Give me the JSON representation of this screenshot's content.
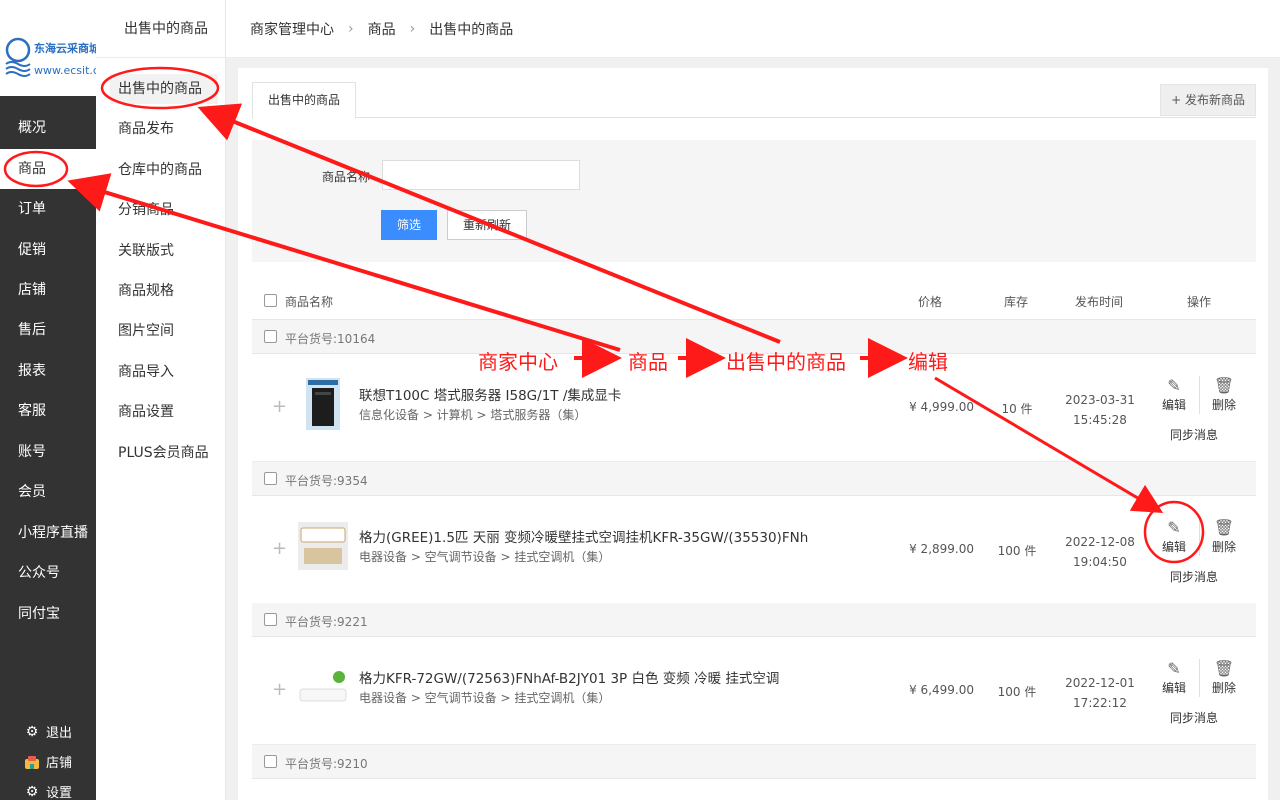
{
  "brand": {
    "name": "东海云采商城",
    "url": "www.ecsit.cn"
  },
  "sidebar": {
    "items": [
      {
        "label": "概况"
      },
      {
        "label": "商品"
      },
      {
        "label": "订单"
      },
      {
        "label": "促销"
      },
      {
        "label": "店铺"
      },
      {
        "label": "售后"
      },
      {
        "label": "报表"
      },
      {
        "label": "客服"
      },
      {
        "label": "账号"
      },
      {
        "label": "会员"
      },
      {
        "label": "小程序直播"
      },
      {
        "label": "公众号"
      },
      {
        "label": "同付宝"
      }
    ],
    "bottom": {
      "logout": "退出",
      "shop": "店铺",
      "settings": "设置"
    }
  },
  "subnav": {
    "title": "出售中的商品",
    "items": [
      {
        "label": "出售中的商品"
      },
      {
        "label": "商品发布"
      },
      {
        "label": "仓库中的商品"
      },
      {
        "label": "分销商品"
      },
      {
        "label": "关联版式"
      },
      {
        "label": "商品规格"
      },
      {
        "label": "图片空间"
      },
      {
        "label": "商品导入"
      },
      {
        "label": "商品设置"
      },
      {
        "label": "PLUS会员商品"
      }
    ]
  },
  "breadcrumb": {
    "root": "商家管理中心",
    "level1": "商品",
    "level2": "出售中的商品",
    "sep": "›"
  },
  "tabs": {
    "active": "出售中的商品",
    "publish_btn": "+ 发布新商品"
  },
  "filter": {
    "name_label": "商品名称",
    "name_value": "",
    "filter_btn": "筛选",
    "refresh_btn": "重新刷新"
  },
  "table": {
    "headers": {
      "name": "商品名称",
      "price": "价格",
      "stock": "库存",
      "time": "发布时间",
      "actions": "操作"
    },
    "edit_label": "编辑",
    "delete_label": "删除",
    "sync_label": "同步消息",
    "rows": [
      {
        "sku": "平台货号:10164",
        "name": "联想T100C 塔式服务器 I58G/1T /集成显卡",
        "category": "信息化设备 > 计算机 > 塔式服务器（集）",
        "price": "¥ 4,999.00",
        "stock": "10 件",
        "date": "2023-03-31",
        "time": "15:45:28"
      },
      {
        "sku": "平台货号:9354",
        "name": "格力(GREE)1.5匹 天丽 变频冷暖壁挂式空调挂机KFR-35GW/(35530)FNh",
        "category": "电器设备 > 空气调节设备 > 挂式空调机（集）",
        "price": "¥ 2,899.00",
        "stock": "100 件",
        "date": "2022-12-08",
        "time": "19:04:50"
      },
      {
        "sku": "平台货号:9221",
        "name": "格力KFR-72GW/(72563)FNhAf-B2JY01 3P 白色 变频 冷暖 挂式空调",
        "category": "电器设备 > 空气调节设备 > 挂式空调机（集）",
        "price": "¥ 6,499.00",
        "stock": "100 件",
        "date": "2022-12-01",
        "time": "17:22:12"
      }
    ],
    "next_sku": "平台货号:9210"
  },
  "annotation": {
    "steps": [
      "商家中心",
      "商品",
      "出售中的商品",
      "编辑"
    ],
    "color": "#ff1a1a"
  }
}
